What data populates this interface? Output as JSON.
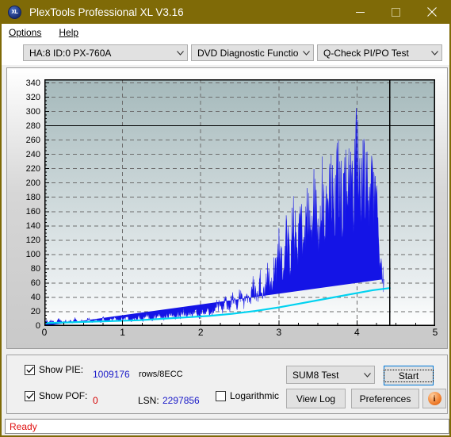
{
  "window": {
    "title": "PlexTools Professional XL V3.16",
    "icon": "xl-logo-icon",
    "icon_text": "XL",
    "titlebar_color": "#7f6a07",
    "minimize": "minimize-icon",
    "maximize": "maximize-icon",
    "close": "close-icon"
  },
  "menubar": {
    "items": [
      {
        "label": "Options",
        "accel": "O"
      },
      {
        "label": "Help",
        "accel": "H"
      }
    ]
  },
  "toolbar": {
    "drive_select": {
      "value": "HA:8 ID:0  PX-760A"
    },
    "function_select": {
      "value": "DVD Diagnostic Functions"
    },
    "test_select": {
      "value": "Q-Check PI/PO Test"
    }
  },
  "chart_data": {
    "type": "area",
    "title": "",
    "xlabel": "",
    "ylabel": "",
    "xlim": [
      0,
      5
    ],
    "ylim": [
      0,
      345
    ],
    "yticks": [
      0,
      20,
      40,
      60,
      80,
      100,
      120,
      140,
      160,
      180,
      200,
      220,
      240,
      260,
      280,
      300,
      320,
      340
    ],
    "xticks": [
      0,
      1,
      2,
      3,
      4,
      5
    ],
    "grid": true,
    "legend_position": "none",
    "threshold_line": 280,
    "data_end_x": 4.42,
    "background_top_color": "#a5b9bb",
    "background_bottom_color": "#ffffff",
    "series": [
      {
        "name": "PIE",
        "color": "#1414e6",
        "type": "bar",
        "max_value": 305,
        "avg_at_end": 140,
        "x": [
          0.0,
          0.03,
          0.06,
          0.09,
          0.12,
          0.15,
          0.18,
          0.21,
          0.24,
          0.27,
          0.3,
          0.33,
          0.36,
          0.39,
          0.42,
          0.45,
          0.48,
          0.51,
          0.54,
          0.57,
          0.6,
          0.63,
          0.66,
          0.69,
          0.72,
          0.75,
          0.78,
          0.81,
          0.84,
          0.87,
          0.9,
          0.93,
          0.96,
          0.99,
          1.02,
          1.05,
          1.08,
          1.11,
          1.14,
          1.17,
          1.2,
          1.23,
          1.26,
          1.29,
          1.32,
          1.35,
          1.38,
          1.41,
          1.44,
          1.47,
          1.5,
          1.53,
          1.56,
          1.59,
          1.62,
          1.65,
          1.68,
          1.71,
          1.74,
          1.77,
          1.8,
          1.83,
          1.86,
          1.89,
          1.92,
          1.95,
          1.98,
          2.01,
          2.04,
          2.07,
          2.1,
          2.13,
          2.16,
          2.19,
          2.22,
          2.25,
          2.28,
          2.31,
          2.34,
          2.37,
          2.4,
          2.43,
          2.46,
          2.49,
          2.52,
          2.55,
          2.58,
          2.61,
          2.64,
          2.67,
          2.7,
          2.73,
          2.76,
          2.79,
          2.82,
          2.85,
          2.88,
          2.91,
          2.94,
          2.97,
          3.0,
          3.03,
          3.06,
          3.09,
          3.12,
          3.15,
          3.18,
          3.21,
          3.24,
          3.27,
          3.3,
          3.33,
          3.36,
          3.39,
          3.42,
          3.45,
          3.48,
          3.51,
          3.54,
          3.57,
          3.6,
          3.63,
          3.66,
          3.69,
          3.72,
          3.75,
          3.78,
          3.81,
          3.84,
          3.87,
          3.9,
          3.93,
          3.96,
          3.99,
          4.02,
          4.05,
          4.08,
          4.11,
          4.14,
          4.17,
          4.2,
          4.23,
          4.26,
          4.29,
          4.32,
          4.35,
          4.38,
          4.41
        ],
        "values": [
          6,
          8,
          5,
          9,
          6,
          4,
          10,
          7,
          5,
          8,
          6,
          9,
          5,
          11,
          7,
          6,
          9,
          5,
          8,
          12,
          7,
          6,
          10,
          8,
          5,
          13,
          9,
          7,
          11,
          8,
          14,
          10,
          7,
          12,
          9,
          15,
          11,
          8,
          13,
          10,
          16,
          12,
          9,
          14,
          18,
          12,
          10,
          16,
          13,
          20,
          15,
          11,
          18,
          14,
          22,
          16,
          12,
          19,
          15,
          24,
          18,
          14,
          21,
          17,
          26,
          20,
          15,
          23,
          19,
          28,
          22,
          17,
          25,
          30,
          35,
          27,
          22,
          40,
          33,
          28,
          45,
          38,
          30,
          50,
          43,
          36,
          58,
          48,
          40,
          65,
          55,
          46,
          75,
          62,
          52,
          85,
          72,
          60,
          95,
          80,
          135,
          105,
          88,
          150,
          120,
          100,
          165,
          138,
          115,
          180,
          150,
          128,
          195,
          165,
          140,
          210,
          175,
          150,
          225,
          190,
          160,
          205,
          240,
          200,
          175,
          250,
          215,
          185,
          235,
          205,
          265,
          225,
          195,
          305,
          255,
          215,
          270,
          230,
          200,
          245,
          215,
          185,
          160,
          120,
          90,
          55
        ]
      },
      {
        "name": "POF-average",
        "color": "#00d2f0",
        "type": "line",
        "x": [
          0.0,
          0.3,
          0.6,
          0.9,
          1.2,
          1.5,
          1.8,
          2.1,
          2.4,
          2.7,
          3.0,
          3.3,
          3.6,
          3.9,
          4.2,
          4.42
        ],
        "values": [
          4,
          5,
          6,
          7,
          8,
          10,
          12,
          14,
          17,
          21,
          26,
          32,
          38,
          44,
          50,
          53
        ]
      }
    ]
  },
  "controls": {
    "show_pie": {
      "label": "Show PIE:",
      "accel": "",
      "checked": true,
      "value": "1009176",
      "unit": "rows/8ECC"
    },
    "show_pof": {
      "label": "Show POF:",
      "accel": "F",
      "checked": true,
      "value": "0"
    },
    "lsn": {
      "label": "LSN:",
      "value": "2297856"
    },
    "logarithmic": {
      "label": "Logarithmic",
      "checked": false
    },
    "test_mode_select": {
      "value": "SUM8 Test"
    },
    "start_button": {
      "label": "Start",
      "accel": "S"
    },
    "view_log_button": {
      "label": "View Log",
      "accel": "V"
    },
    "preferences_button": {
      "label": "Preferences",
      "accel": "P"
    },
    "info_button": {
      "label": "i"
    }
  },
  "statusbar": {
    "text": "Ready",
    "color": "#e01010"
  }
}
